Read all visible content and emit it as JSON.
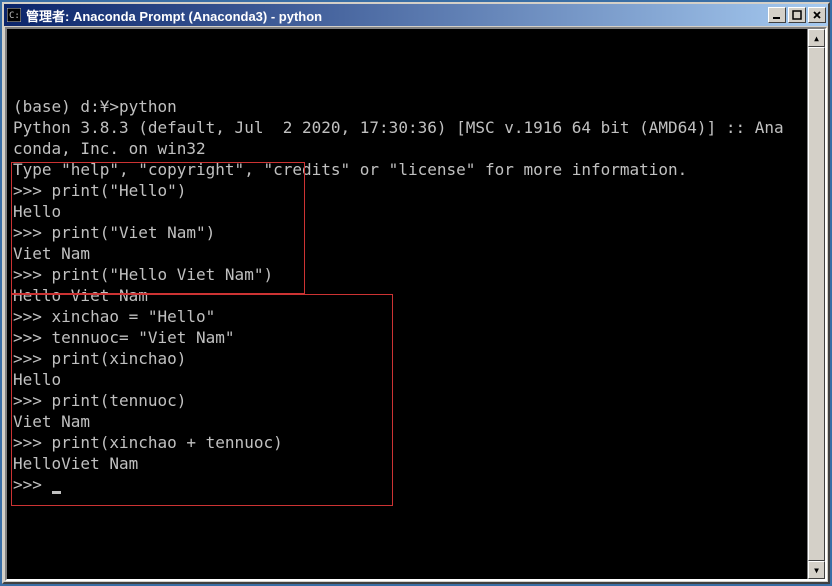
{
  "window": {
    "title": "管理者: Anaconda Prompt (Anaconda3) - python",
    "icon_name": "terminal-icon"
  },
  "buttons": {
    "minimize": "_",
    "maximize": "□",
    "close": "×"
  },
  "scrollbar": {
    "up": "▲",
    "down": "▼"
  },
  "terminal": {
    "lines": [
      "",
      "(base) d:¥>python",
      "Python 3.8.3 (default, Jul  2 2020, 17:30:36) [MSC v.1916 64 bit (AMD64)] :: Ana",
      "conda, Inc. on win32",
      "Type \"help\", \"copyright\", \"credits\" or \"license\" for more information.",
      ">>> print(\"Hello\")",
      "Hello",
      ">>> print(\"Viet Nam\")",
      "Viet Nam",
      ">>> print(\"Hello Viet Nam\")",
      "Hello Viet Nam",
      ">>> xinchao = \"Hello\"",
      ">>> tennuoc= \"Viet Nam\"",
      ">>> print(xinchao)",
      "Hello",
      ">>> print(tennuoc)",
      "Viet Nam",
      ">>> print(xinchao + tennuoc)",
      "HelloViet Nam",
      ">>> "
    ]
  }
}
